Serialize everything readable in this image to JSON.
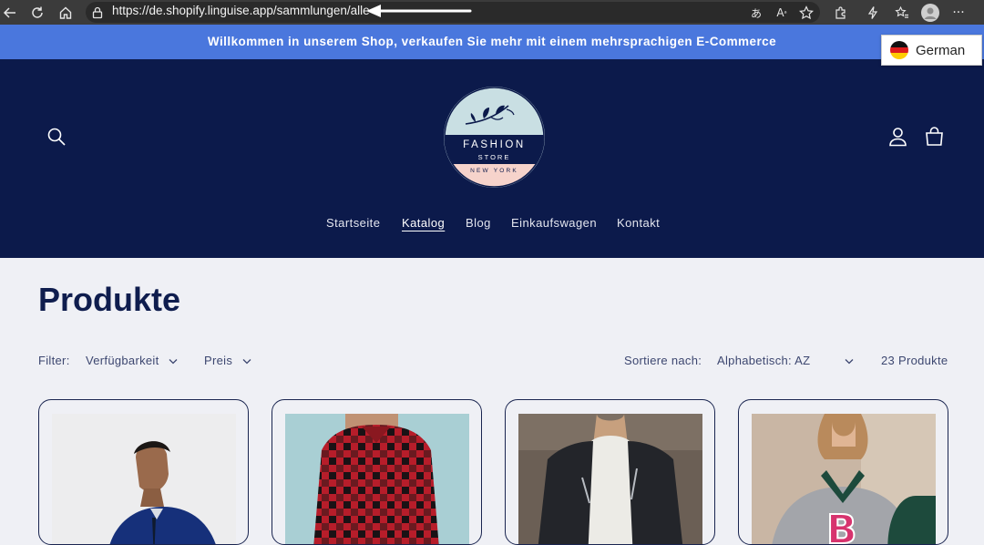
{
  "browser": {
    "url": "https://de.shopify.linguise.app/sammlungen/alle",
    "icons": [
      "back-icon",
      "reload-icon",
      "home-icon",
      "lock-icon",
      "read-aloud-icon",
      "translate-icon",
      "favorite-star-icon",
      "extensions-icon",
      "performance-icon",
      "favorites-list-icon",
      "profile-avatar-icon",
      "more-icon"
    ]
  },
  "announcement": {
    "text": "Willkommen in unserem Shop, verkaufen Sie mehr mit einem mehrsprachigen E-Commerce"
  },
  "language_switcher": {
    "label": "German"
  },
  "logo": {
    "line1": "FASHION",
    "line2": "STORE",
    "line3": "NEW YORK"
  },
  "nav": {
    "items": [
      {
        "label": "Startseite"
      },
      {
        "label": "Katalog"
      },
      {
        "label": "Blog"
      },
      {
        "label": "Einkaufswagen"
      },
      {
        "label": "Kontakt"
      }
    ],
    "active": "Katalog"
  },
  "collection": {
    "title": "Produkte",
    "filter_label": "Filter:",
    "filter_availability": "Verfügbarkeit",
    "filter_price": "Preis",
    "sort_label": "Sortiere nach:",
    "sort_value": "Alphabetisch: AZ",
    "count": "23 Produkte"
  },
  "colors": {
    "header_bg": "#0c1a4b",
    "announcement_bg": "#4a77dd",
    "page_bg": "#eff0f5",
    "title_color": "#0f1d4e"
  }
}
